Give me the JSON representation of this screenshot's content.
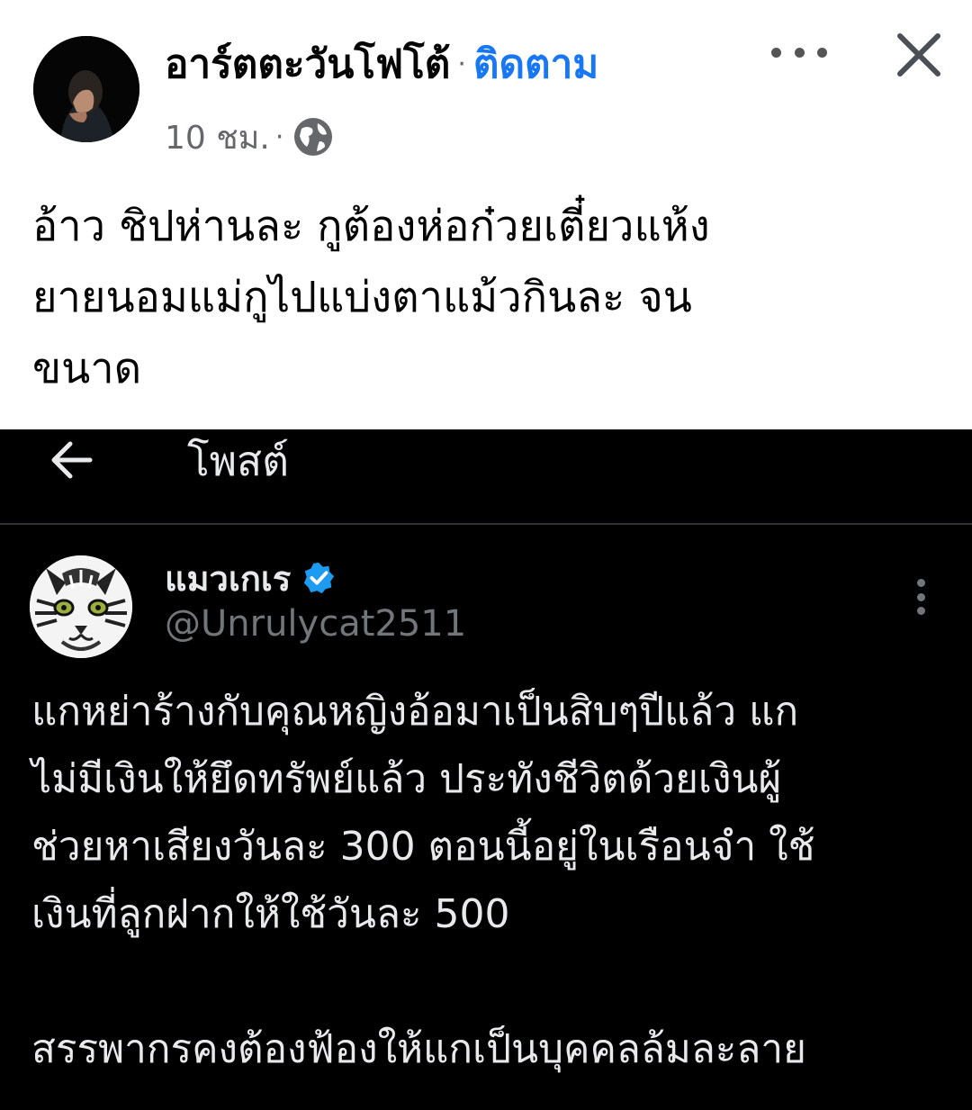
{
  "post": {
    "author_name": "อาร์ตตะวันโฟโต้",
    "separator": "·",
    "follow_label": "ติดตาม",
    "time": "10 ชม.",
    "audience_icon": "globe-icon",
    "more_icon": "more-horizontal-icon",
    "close_icon": "close-icon",
    "text_lines": [
      "อ้าว ชิปห่านละ กูต้องห่อก๋วยเตี๋ยวแห้ง",
      "ยายนอมแม่กูไปแบ่งตาแม้วกินละ จน",
      "ขนาด"
    ]
  },
  "embedded_tweet": {
    "header_title": "โพสต์",
    "back_icon": "back-arrow-icon",
    "display_name": "แมวเกเร",
    "verified_icon": "verified-badge-icon",
    "handle": "@Unrulycat2511",
    "more_icon": "more-vertical-icon",
    "paragraph1_lines": [
      "แกหย่าร้างกับคุณหญิงอ้อมาเป็นสิบๆปีแล้ว แก",
      "ไม่มีเงินให้ยึดทรัพย์แล้ว ประทังชีวิตด้วยเงินผู้",
      "ช่วยหาเสียงวันละ 300 ตอนนี้อยู่ในเรือนจำ ใช้",
      "เงินที่ลูกฝากให้ใช้วันละ 500"
    ],
    "paragraph2_lines": [
      "สรรพากรคงต้องฟ้องให้แกเป็นบุคคลล้มละลาย"
    ]
  },
  "colors": {
    "follow_blue": "#1877f2",
    "verified_blue": "#1d9bf0",
    "tweet_background": "#000000",
    "tweet_text": "#e7e9ea",
    "tweet_muted": "#71767b"
  }
}
